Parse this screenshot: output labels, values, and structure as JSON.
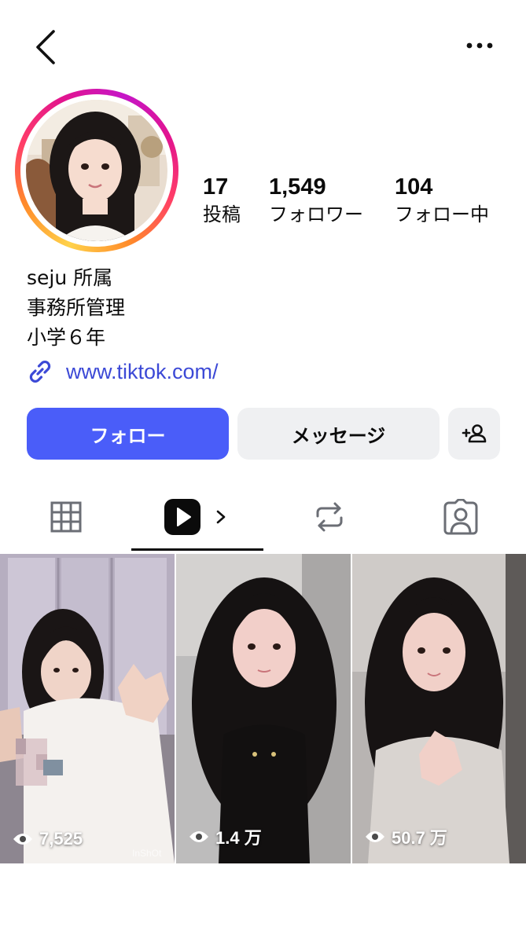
{
  "profile": {
    "stats": [
      {
        "value": "17",
        "label": "投稿"
      },
      {
        "value": "1,549",
        "label": "フォロワー"
      },
      {
        "value": "104",
        "label": "フォロー中"
      }
    ],
    "bio": [
      "seju 所属",
      "事務所管理",
      "小学６年"
    ],
    "link": "www.tiktok.com/"
  },
  "buttons": {
    "follow": "フォロー",
    "message": "メッセージ"
  },
  "tabs": [
    "grid-icon",
    "reels-icon",
    "reposts-icon",
    "tagged-icon"
  ],
  "active_tab": "reels",
  "videos": [
    {
      "views": "7,525",
      "watermark": "InShOt"
    },
    {
      "views": "1.4 万"
    },
    {
      "views": "50.7 万"
    }
  ],
  "colors": {
    "accent": "#4a5df9",
    "link": "#3c49d6",
    "button_gray": "#eff0f2"
  }
}
